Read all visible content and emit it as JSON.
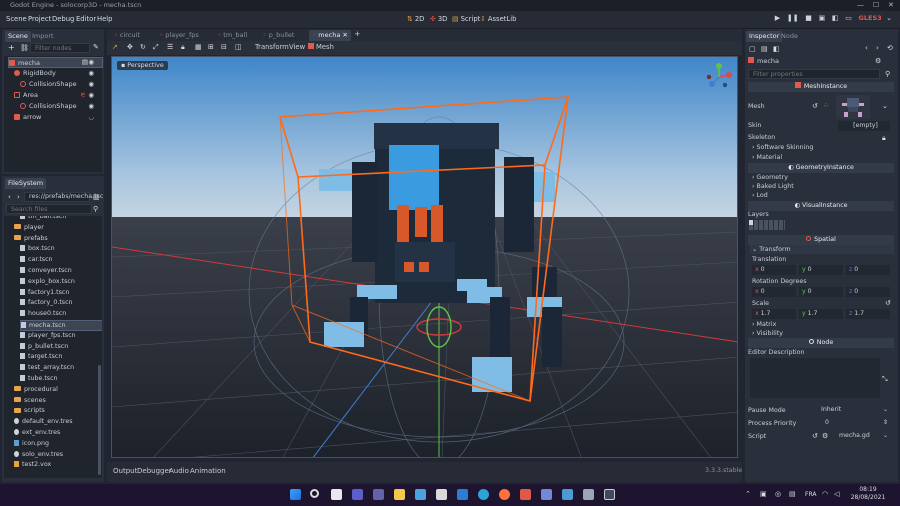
{
  "window": {
    "title": "Godot Engine - solocorp3D - mecha.tscn"
  },
  "menus": [
    "Scene",
    "Project",
    "Debug",
    "Editor",
    "Help"
  ],
  "workspaces": [
    {
      "label": "2D"
    },
    {
      "label": "3D",
      "active": true
    },
    {
      "label": "Script"
    },
    {
      "label": "AssetLib"
    }
  ],
  "renderer": "GLES3",
  "scene_dock": {
    "tabs": [
      "Scene",
      "Import"
    ],
    "filter_placeholder": "Filter nodes",
    "nodes": [
      {
        "label": "mecha",
        "indent": 0,
        "color": "#e05a4e",
        "selected": true
      },
      {
        "label": "RigidBody",
        "indent": 1,
        "color": "#e05a4e"
      },
      {
        "label": "CollisionShape",
        "indent": 2,
        "color": "#e05a4e"
      },
      {
        "label": "Area",
        "indent": 1,
        "color": "#e05a4e"
      },
      {
        "label": "CollisionShape",
        "indent": 2,
        "color": "#e05a4e"
      },
      {
        "label": "arrow",
        "indent": 1,
        "color": "#e05a4e"
      }
    ]
  },
  "filesystem": {
    "tab": "FileSystem",
    "path": "res://prefabs/mecha.tsc",
    "search_placeholder": "Search files",
    "items": [
      {
        "label": "tm_ball.tscn",
        "type": "file",
        "indent": 2
      },
      {
        "label": "player",
        "type": "folder",
        "indent": 1
      },
      {
        "label": "prefabs",
        "type": "folder",
        "indent": 1
      },
      {
        "label": "box.tscn",
        "type": "file",
        "indent": 2
      },
      {
        "label": "car.tscn",
        "type": "file",
        "indent": 2
      },
      {
        "label": "conveyer.tscn",
        "type": "file",
        "indent": 2
      },
      {
        "label": "explo_box.tscn",
        "type": "file",
        "indent": 2
      },
      {
        "label": "factory1.tscn",
        "type": "file",
        "indent": 2
      },
      {
        "label": "factory_0.tscn",
        "type": "file",
        "indent": 2
      },
      {
        "label": "house0.tscn",
        "type": "file",
        "indent": 2
      },
      {
        "label": "mecha.tscn",
        "type": "file",
        "indent": 2,
        "selected": true
      },
      {
        "label": "player_fps.tscn",
        "type": "file",
        "indent": 2
      },
      {
        "label": "p_bullet.tscn",
        "type": "file",
        "indent": 2
      },
      {
        "label": "target.tscn",
        "type": "file",
        "indent": 2
      },
      {
        "label": "test_array.tscn",
        "type": "file",
        "indent": 2
      },
      {
        "label": "tube.tscn",
        "type": "file",
        "indent": 2
      },
      {
        "label": "procedural",
        "type": "folder",
        "indent": 1
      },
      {
        "label": "scenes",
        "type": "folder",
        "indent": 1
      },
      {
        "label": "scripts",
        "type": "folder",
        "indent": 1
      },
      {
        "label": "default_env.tres",
        "type": "res",
        "indent": 1
      },
      {
        "label": "ext_env.tres",
        "type": "res",
        "indent": 1
      },
      {
        "label": "icon.png",
        "type": "img",
        "indent": 1
      },
      {
        "label": "solo_env.tres",
        "type": "res",
        "indent": 1
      },
      {
        "label": "test2.vox",
        "type": "vox",
        "indent": 1
      }
    ]
  },
  "editor_tabs": [
    {
      "label": "circuit"
    },
    {
      "label": "player_fps"
    },
    {
      "label": "tm_ball"
    },
    {
      "label": "p_bullet"
    },
    {
      "label": "mecha",
      "active": true
    }
  ],
  "viewport": {
    "menus": [
      "Transform",
      "View",
      "Mesh"
    ],
    "view_label": "Perspective"
  },
  "bottom_panel": {
    "tabs": [
      "Output",
      "Debugger",
      "Audio",
      "Animation"
    ],
    "version": "3.3.3.stable"
  },
  "inspector": {
    "tabs": [
      "Inspector",
      "Node"
    ],
    "object_name": "mecha",
    "filter_placeholder": "Filter properties",
    "class_header": "MeshInstance",
    "mesh_label": "Mesh",
    "skin_label": "Skin",
    "skin_value": "[empty]",
    "skeleton_label": "Skeleton",
    "groups_a": [
      "Software Skinning",
      "Material"
    ],
    "geometry_header": "GeometryInstance",
    "groups_b": [
      "Geometry",
      "Baked Light",
      "Lod"
    ],
    "visual_header": "VisualInstance",
    "layers_label": "Layers",
    "spatial_header": "Spatial",
    "transform_group": "Transform",
    "translation_label": "Translation",
    "translation": [
      "0",
      "0",
      "0"
    ],
    "rotation_label": "Rotation Degrees",
    "rotation": [
      "0",
      "0",
      "0"
    ],
    "scale_label": "Scale",
    "scale": [
      "1.7",
      "1.7",
      "1.7"
    ],
    "groups_c": [
      "Matrix",
      "Visibility"
    ],
    "node_header": "Node",
    "editor_description_label": "Editor Description",
    "pause_mode_label": "Pause Mode",
    "pause_mode_value": "Inherit",
    "process_priority_label": "Process Priority",
    "process_priority_value": "0",
    "script_label": "Script",
    "script_value": "mecha.gd"
  },
  "taskbar": {
    "lang": "FRA",
    "time": "08:19",
    "date": "28/08/2021"
  },
  "colors": {
    "accent": "#e05a4e",
    "orange_box": "#ff6a1a",
    "sky": "#5b9fd6",
    "ground": "#262a34"
  }
}
